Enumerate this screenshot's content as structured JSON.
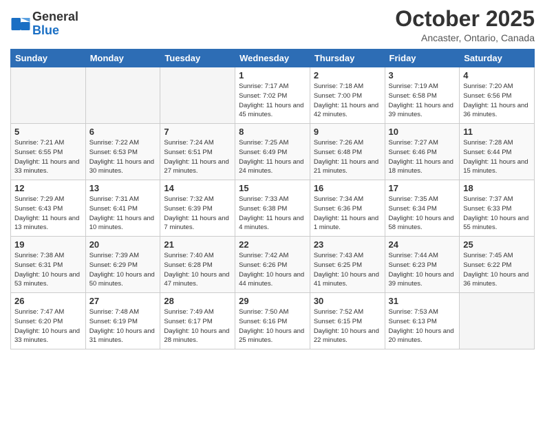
{
  "header": {
    "logo_line1": "General",
    "logo_line2": "Blue",
    "month_title": "October 2025",
    "location": "Ancaster, Ontario, Canada"
  },
  "days_of_week": [
    "Sunday",
    "Monday",
    "Tuesday",
    "Wednesday",
    "Thursday",
    "Friday",
    "Saturday"
  ],
  "weeks": [
    {
      "shaded": false,
      "days": [
        {
          "num": "",
          "empty": true
        },
        {
          "num": "",
          "empty": true
        },
        {
          "num": "",
          "empty": true
        },
        {
          "num": "1",
          "sunrise": "Sunrise: 7:17 AM",
          "sunset": "Sunset: 7:02 PM",
          "daylight": "Daylight: 11 hours and 45 minutes."
        },
        {
          "num": "2",
          "sunrise": "Sunrise: 7:18 AM",
          "sunset": "Sunset: 7:00 PM",
          "daylight": "Daylight: 11 hours and 42 minutes."
        },
        {
          "num": "3",
          "sunrise": "Sunrise: 7:19 AM",
          "sunset": "Sunset: 6:58 PM",
          "daylight": "Daylight: 11 hours and 39 minutes."
        },
        {
          "num": "4",
          "sunrise": "Sunrise: 7:20 AM",
          "sunset": "Sunset: 6:56 PM",
          "daylight": "Daylight: 11 hours and 36 minutes."
        }
      ]
    },
    {
      "shaded": true,
      "days": [
        {
          "num": "5",
          "sunrise": "Sunrise: 7:21 AM",
          "sunset": "Sunset: 6:55 PM",
          "daylight": "Daylight: 11 hours and 33 minutes."
        },
        {
          "num": "6",
          "sunrise": "Sunrise: 7:22 AM",
          "sunset": "Sunset: 6:53 PM",
          "daylight": "Daylight: 11 hours and 30 minutes."
        },
        {
          "num": "7",
          "sunrise": "Sunrise: 7:24 AM",
          "sunset": "Sunset: 6:51 PM",
          "daylight": "Daylight: 11 hours and 27 minutes."
        },
        {
          "num": "8",
          "sunrise": "Sunrise: 7:25 AM",
          "sunset": "Sunset: 6:49 PM",
          "daylight": "Daylight: 11 hours and 24 minutes."
        },
        {
          "num": "9",
          "sunrise": "Sunrise: 7:26 AM",
          "sunset": "Sunset: 6:48 PM",
          "daylight": "Daylight: 11 hours and 21 minutes."
        },
        {
          "num": "10",
          "sunrise": "Sunrise: 7:27 AM",
          "sunset": "Sunset: 6:46 PM",
          "daylight": "Daylight: 11 hours and 18 minutes."
        },
        {
          "num": "11",
          "sunrise": "Sunrise: 7:28 AM",
          "sunset": "Sunset: 6:44 PM",
          "daylight": "Daylight: 11 hours and 15 minutes."
        }
      ]
    },
    {
      "shaded": false,
      "days": [
        {
          "num": "12",
          "sunrise": "Sunrise: 7:29 AM",
          "sunset": "Sunset: 6:43 PM",
          "daylight": "Daylight: 11 hours and 13 minutes."
        },
        {
          "num": "13",
          "sunrise": "Sunrise: 7:31 AM",
          "sunset": "Sunset: 6:41 PM",
          "daylight": "Daylight: 11 hours and 10 minutes."
        },
        {
          "num": "14",
          "sunrise": "Sunrise: 7:32 AM",
          "sunset": "Sunset: 6:39 PM",
          "daylight": "Daylight: 11 hours and 7 minutes."
        },
        {
          "num": "15",
          "sunrise": "Sunrise: 7:33 AM",
          "sunset": "Sunset: 6:38 PM",
          "daylight": "Daylight: 11 hours and 4 minutes."
        },
        {
          "num": "16",
          "sunrise": "Sunrise: 7:34 AM",
          "sunset": "Sunset: 6:36 PM",
          "daylight": "Daylight: 11 hours and 1 minute."
        },
        {
          "num": "17",
          "sunrise": "Sunrise: 7:35 AM",
          "sunset": "Sunset: 6:34 PM",
          "daylight": "Daylight: 10 hours and 58 minutes."
        },
        {
          "num": "18",
          "sunrise": "Sunrise: 7:37 AM",
          "sunset": "Sunset: 6:33 PM",
          "daylight": "Daylight: 10 hours and 55 minutes."
        }
      ]
    },
    {
      "shaded": true,
      "days": [
        {
          "num": "19",
          "sunrise": "Sunrise: 7:38 AM",
          "sunset": "Sunset: 6:31 PM",
          "daylight": "Daylight: 10 hours and 53 minutes."
        },
        {
          "num": "20",
          "sunrise": "Sunrise: 7:39 AM",
          "sunset": "Sunset: 6:29 PM",
          "daylight": "Daylight: 10 hours and 50 minutes."
        },
        {
          "num": "21",
          "sunrise": "Sunrise: 7:40 AM",
          "sunset": "Sunset: 6:28 PM",
          "daylight": "Daylight: 10 hours and 47 minutes."
        },
        {
          "num": "22",
          "sunrise": "Sunrise: 7:42 AM",
          "sunset": "Sunset: 6:26 PM",
          "daylight": "Daylight: 10 hours and 44 minutes."
        },
        {
          "num": "23",
          "sunrise": "Sunrise: 7:43 AM",
          "sunset": "Sunset: 6:25 PM",
          "daylight": "Daylight: 10 hours and 41 minutes."
        },
        {
          "num": "24",
          "sunrise": "Sunrise: 7:44 AM",
          "sunset": "Sunset: 6:23 PM",
          "daylight": "Daylight: 10 hours and 39 minutes."
        },
        {
          "num": "25",
          "sunrise": "Sunrise: 7:45 AM",
          "sunset": "Sunset: 6:22 PM",
          "daylight": "Daylight: 10 hours and 36 minutes."
        }
      ]
    },
    {
      "shaded": false,
      "days": [
        {
          "num": "26",
          "sunrise": "Sunrise: 7:47 AM",
          "sunset": "Sunset: 6:20 PM",
          "daylight": "Daylight: 10 hours and 33 minutes."
        },
        {
          "num": "27",
          "sunrise": "Sunrise: 7:48 AM",
          "sunset": "Sunset: 6:19 PM",
          "daylight": "Daylight: 10 hours and 31 minutes."
        },
        {
          "num": "28",
          "sunrise": "Sunrise: 7:49 AM",
          "sunset": "Sunset: 6:17 PM",
          "daylight": "Daylight: 10 hours and 28 minutes."
        },
        {
          "num": "29",
          "sunrise": "Sunrise: 7:50 AM",
          "sunset": "Sunset: 6:16 PM",
          "daylight": "Daylight: 10 hours and 25 minutes."
        },
        {
          "num": "30",
          "sunrise": "Sunrise: 7:52 AM",
          "sunset": "Sunset: 6:15 PM",
          "daylight": "Daylight: 10 hours and 22 minutes."
        },
        {
          "num": "31",
          "sunrise": "Sunrise: 7:53 AM",
          "sunset": "Sunset: 6:13 PM",
          "daylight": "Daylight: 10 hours and 20 minutes."
        },
        {
          "num": "",
          "empty": true
        }
      ]
    }
  ]
}
